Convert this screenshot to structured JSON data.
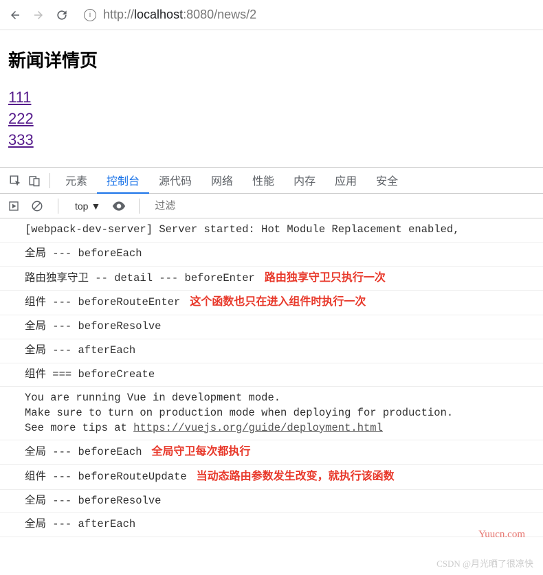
{
  "browser": {
    "url_prefix": "http://",
    "url_host": "localhost",
    "url_port_path": ":8080/news/2"
  },
  "page": {
    "title": "新闻详情页",
    "links": [
      "111",
      "222",
      "333"
    ]
  },
  "devtools": {
    "tabs": [
      "元素",
      "控制台",
      "源代码",
      "网络",
      "性能",
      "内存",
      "应用",
      "安全"
    ],
    "active_tab_index": 1,
    "scope_label": "top",
    "filter_placeholder": "过滤"
  },
  "console_rows": [
    {
      "msg": "[webpack-dev-server] Server started: Hot Module Replacement enabled, ",
      "annot": ""
    },
    {
      "msg": "全局 --- beforeEach",
      "annot": ""
    },
    {
      "msg": "路由独享守卫 -- detail --- beforeEnter",
      "annot": "路由独享守卫只执行一次"
    },
    {
      "msg": "组件 --- beforeRouteEnter",
      "annot": "这个函数也只在进入组件时执行一次"
    },
    {
      "msg": "全局 --- beforeResolve",
      "annot": ""
    },
    {
      "msg": "全局 --- afterEach",
      "annot": ""
    },
    {
      "msg": "组件 === beforeCreate",
      "annot": ""
    },
    {
      "msg_multi": [
        "You are running Vue in development mode.",
        "Make sure to turn on production mode when deploying for production.",
        "See more tips at "
      ],
      "link": "https://vuejs.org/guide/deployment.html",
      "annot": ""
    },
    {
      "msg": "全局 --- beforeEach",
      "annot": "全局守卫每次都执行"
    },
    {
      "msg": "组件 --- beforeRouteUpdate",
      "annot": "当动态路由参数发生改变，就执行该函数"
    },
    {
      "msg": "全局 --- beforeResolve",
      "annot": ""
    },
    {
      "msg": "全局 --- afterEach",
      "annot": ""
    }
  ],
  "watermarks": {
    "w1": "Yuucn.com",
    "w2": "CSDN @月光晒了很凉快"
  }
}
